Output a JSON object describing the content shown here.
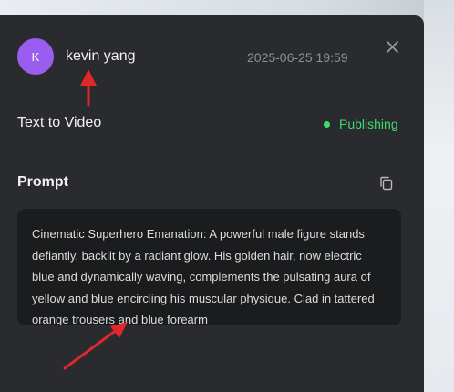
{
  "header": {
    "avatar_initial": "K",
    "avatar_color": "#9b5cf0",
    "username": "kevin yang",
    "timestamp": "2025-06-25 19:59",
    "close_icon": "close-icon"
  },
  "task": {
    "type_label": "Text to Video",
    "status_label": "Publishing",
    "status_color": "#3ddc6a"
  },
  "prompt": {
    "title": "Prompt",
    "copy_icon": "copy-icon",
    "text": "Cinematic Superhero Emanation: A powerful male figure stands defiantly, backlit by a radiant glow. His golden hair, now electric blue and dynamically waving, complements the pulsating aura of yellow and blue encircling his muscular physique. Clad in tattered orange trousers and blue forearm"
  },
  "annotations": {
    "arrow_color": "#e0282a",
    "arrows": [
      "red-arrow-to-username",
      "red-arrow-to-prompt-text"
    ]
  }
}
